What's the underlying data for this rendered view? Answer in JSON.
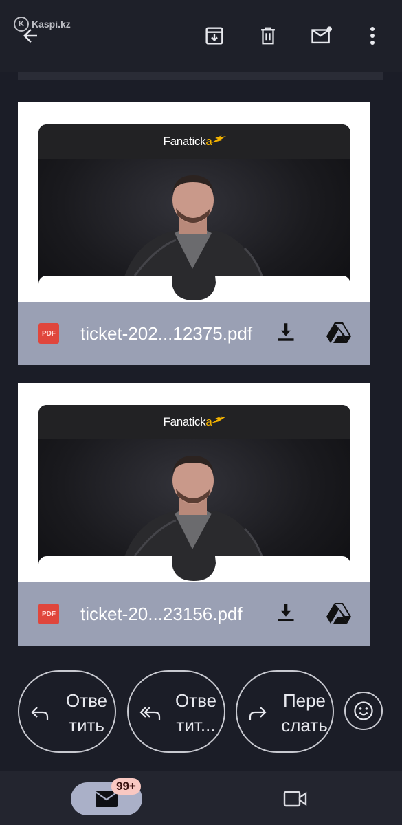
{
  "watermark": {
    "text": "Kaspi.kz"
  },
  "toolbar": {
    "back": "arrow-left-icon",
    "archive": "archive-icon",
    "delete": "trash-icon",
    "mark_unread": "mail-unread-icon",
    "more": "more-vert-icon"
  },
  "attachments": [
    {
      "brand_prefix": "Fanatick",
      "brand_suffix": "a",
      "file_type": "PDF",
      "filename": "ticket-202...12375.pdf",
      "download": "download-icon",
      "drive": "google-drive-icon"
    },
    {
      "brand_prefix": "Fanatick",
      "brand_suffix": "a",
      "file_type": "PDF",
      "filename": "ticket-20...23156.pdf",
      "download": "download-icon",
      "drive": "google-drive-icon"
    }
  ],
  "actions": {
    "reply_line1": "Отве",
    "reply_line2": "тить",
    "reply_all_line1": "Отве",
    "reply_all_line2": "тит...",
    "forward_line1": "Пере",
    "forward_line2": "слать",
    "emoji": "smiley-icon"
  },
  "bottom_nav": {
    "mail": "mail-icon",
    "badge": "99+",
    "meet": "video-camera-icon"
  },
  "colors": {
    "background": "#1b1d27",
    "attachment_footer": "#9aa0b4",
    "pdf_red": "#e0463c",
    "brand_accent": "#f5b400",
    "badge_bg": "#f9c8c2"
  }
}
